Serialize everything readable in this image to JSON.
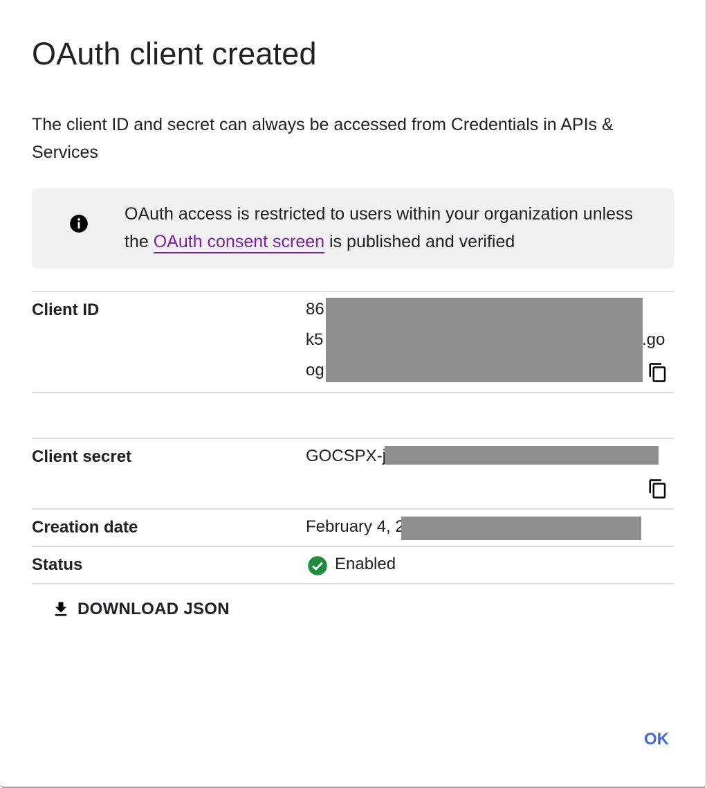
{
  "dialog": {
    "title": "OAuth client created",
    "description": "The client ID and secret can always be accessed from Credentials in APIs & Services"
  },
  "notice": {
    "icon": "info-icon",
    "text_before": "OAuth access is restricted to users within your organization unless the",
    "link_text": "OAuth consent screen",
    "text_after": "is published and verified",
    "link_color": "#7b1fa2"
  },
  "fields": {
    "client_id": {
      "label": "Client ID",
      "line1": "86",
      "line2": "k5",
      "line2_suffix": ".go",
      "line3": "og"
    },
    "client_secret": {
      "label": "Client secret",
      "value": "GOCSPX-j"
    },
    "creation_date": {
      "label": "Creation date",
      "value": "February 4, 2"
    },
    "status": {
      "label": "Status",
      "value": "Enabled",
      "icon": "check-circle-icon",
      "color": "#1e8e3e"
    }
  },
  "actions": {
    "download_label": "DOWNLOAD JSON",
    "ok_label": "OK",
    "ok_color": "#3f6ad8"
  }
}
